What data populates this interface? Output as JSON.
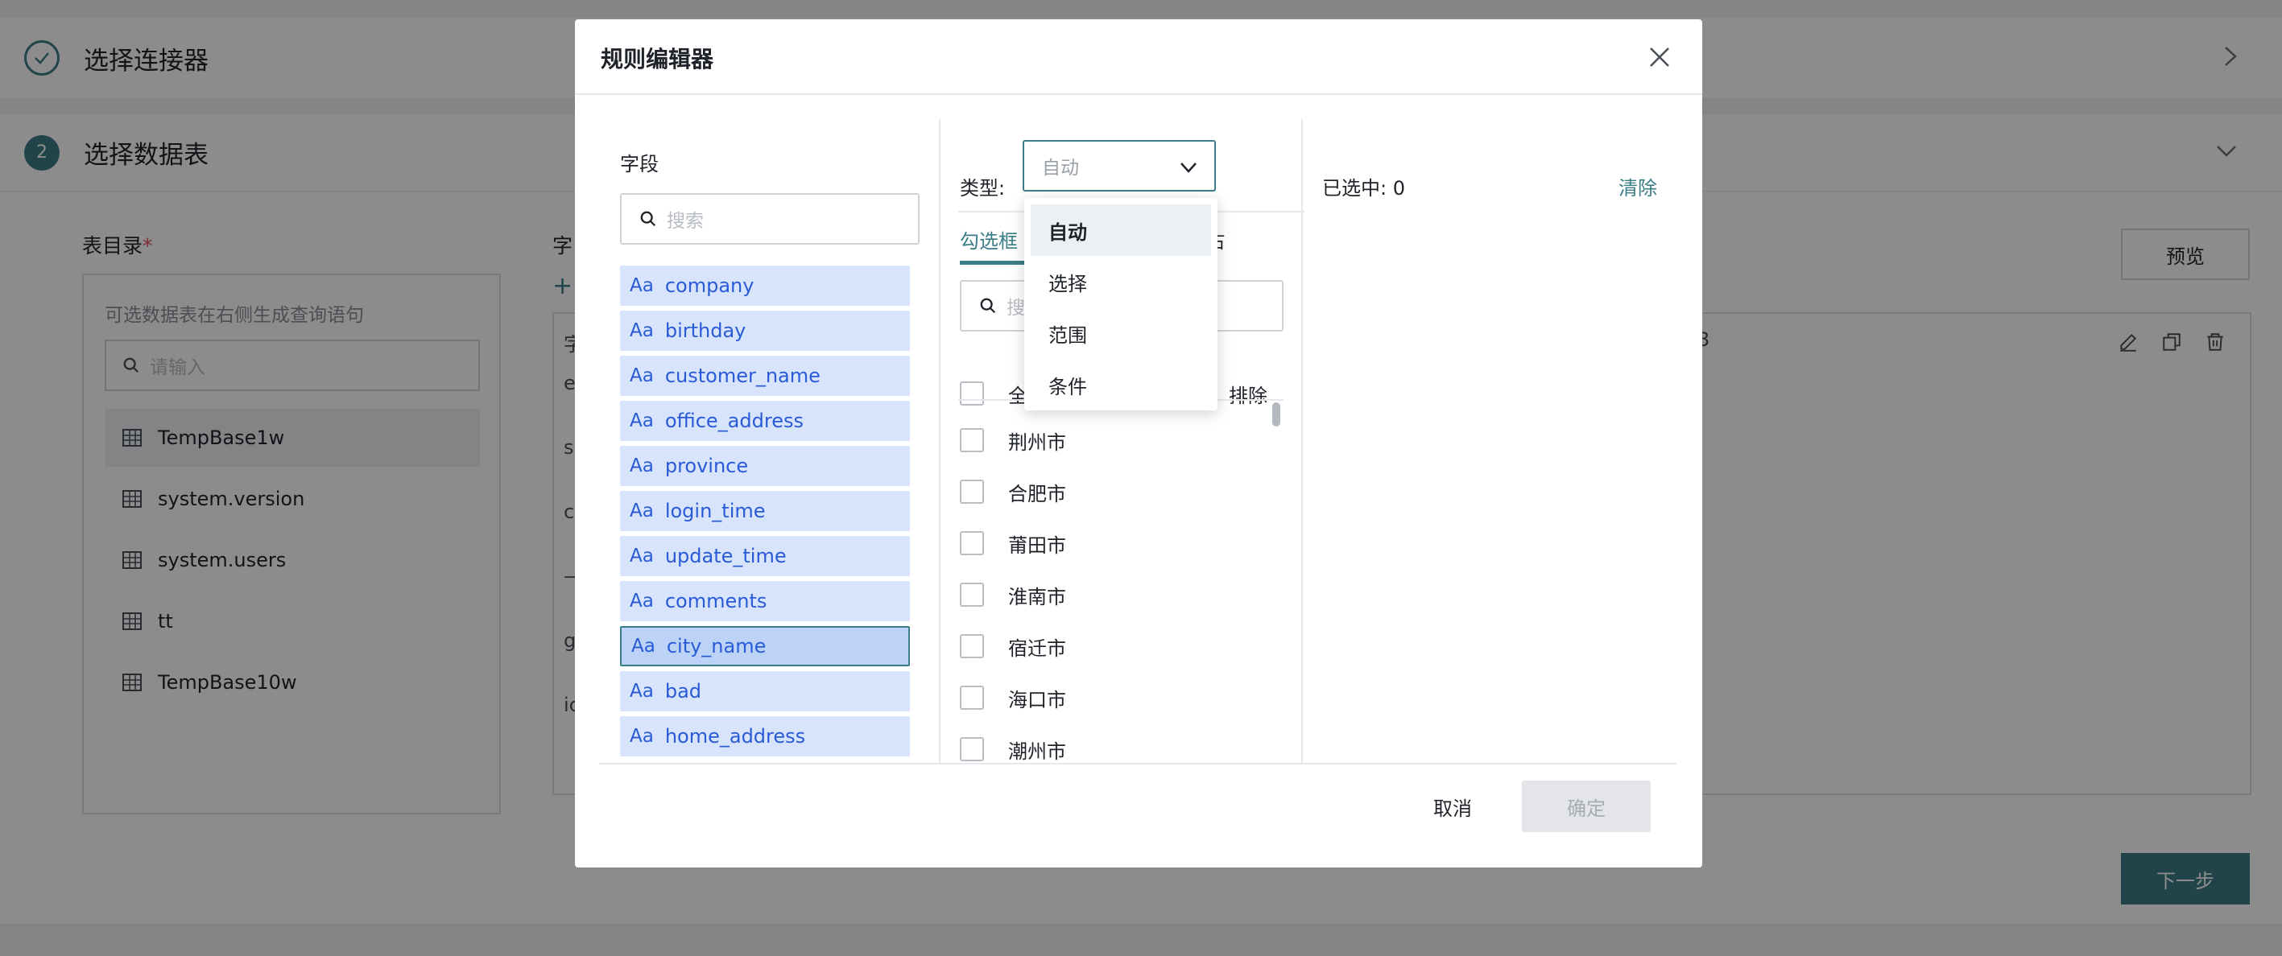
{
  "background": {
    "step1": {
      "title": "选择连接器"
    },
    "step2": {
      "number": "2",
      "title": "选择数据表"
    },
    "table_dir": {
      "label": "表目录",
      "required_mark": "*",
      "hint": "可选数据表在右侧生成查询语句",
      "search_placeholder": "请输入",
      "tables": [
        "TempBase1w",
        "system.version",
        "system.users",
        "tt",
        "TempBase10w"
      ]
    },
    "fragment_label": "字",
    "row_letters": [
      "字",
      "e",
      "s",
      "c",
      "—",
      "g",
      "ic"
    ],
    "table_header_fragment": "3",
    "preview_label": "预览",
    "next_label": "下一步"
  },
  "modal": {
    "title": "规则编辑器",
    "fields_label": "字段",
    "field_search_placeholder": "搜索",
    "field_type_prefix": "Aa",
    "fields": [
      "company",
      "birthday",
      "customer_name",
      "office_address",
      "province",
      "login_time",
      "update_time",
      "comments",
      "city_name",
      "bad",
      "home_address"
    ],
    "selected_field": "city_name",
    "type_label": "类型:",
    "type_placeholder": "自动",
    "tab_active": "勾选框",
    "tab_other_fragment": "占",
    "value_search_placeholder": "搜",
    "select_all": "全",
    "exclude": "排除",
    "values": [
      "荆州市",
      "合肥市",
      "莆田市",
      "淮南市",
      "宿迁市",
      "海口市",
      "潮州市"
    ],
    "type_options": [
      "自动",
      "选择",
      "范围",
      "条件"
    ],
    "type_selected": "自动",
    "selected_count": "已选中: 0",
    "clear": "清除",
    "cancel": "取消",
    "confirm": "确定"
  },
  "colors": {
    "accent": "#3b7d86",
    "field_bg": "#d7e4fb",
    "field_text": "#2a5bd7",
    "required": "#e34d59"
  }
}
